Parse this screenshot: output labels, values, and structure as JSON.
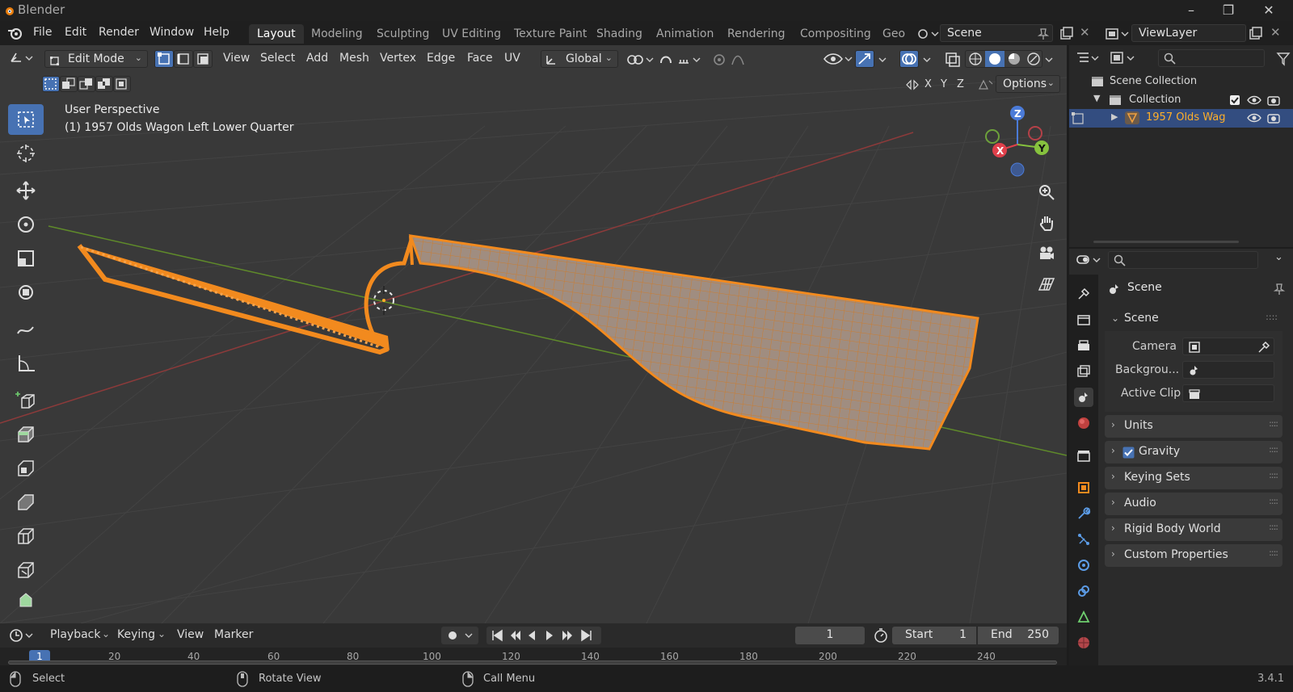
{
  "window": {
    "title": "Blender",
    "version": "3.4.1"
  },
  "menu": [
    "File",
    "Edit",
    "Render",
    "Window",
    "Help"
  ],
  "workspaces": [
    "Layout",
    "Modeling",
    "Sculpting",
    "UV Editing",
    "Texture Paint",
    "Shading",
    "Animation",
    "Rendering",
    "Compositing",
    "Geo"
  ],
  "scene_field": "Scene",
  "viewlayer_field": "ViewLayer",
  "viewport_header": {
    "mode": "Edit Mode",
    "menus": [
      "View",
      "Select",
      "Add",
      "Mesh",
      "Vertex",
      "Edge",
      "Face",
      "UV"
    ],
    "orientation": "Global",
    "options_label": "Options",
    "axes": [
      "X",
      "Y",
      "Z"
    ]
  },
  "overlay_text": {
    "perspective": "User Perspective",
    "object": "(1) 1957 Olds Wagon Left Lower Quarter"
  },
  "gizmo": {
    "x": "X",
    "y": "Y",
    "z": "Z"
  },
  "outliner": {
    "root": "Scene Collection",
    "collection": "Collection",
    "object": "1957 Olds Wag"
  },
  "properties": {
    "title": "Scene",
    "section": "Scene",
    "fields": [
      {
        "label": "Camera"
      },
      {
        "label": "Backgrou..."
      },
      {
        "label": "Active Clip"
      }
    ],
    "panels": [
      "Units",
      "Gravity",
      "Keying Sets",
      "Audio",
      "Rigid Body World",
      "Custom Properties"
    ]
  },
  "timeline": {
    "menus": [
      "Playback",
      "Keying",
      "View",
      "Marker"
    ],
    "current_frame": "1",
    "start_label": "Start",
    "start_value": "1",
    "end_label": "End",
    "end_value": "250",
    "ticks": [
      "1",
      "20",
      "40",
      "60",
      "80",
      "100",
      "120",
      "140",
      "160",
      "180",
      "200",
      "220",
      "240"
    ]
  },
  "status": [
    "Select",
    "Rotate View",
    "Call Menu"
  ],
  "colors": {
    "accent": "#4772b3",
    "mesh": "#f28a1e",
    "selected_text": "#ffaf29"
  }
}
